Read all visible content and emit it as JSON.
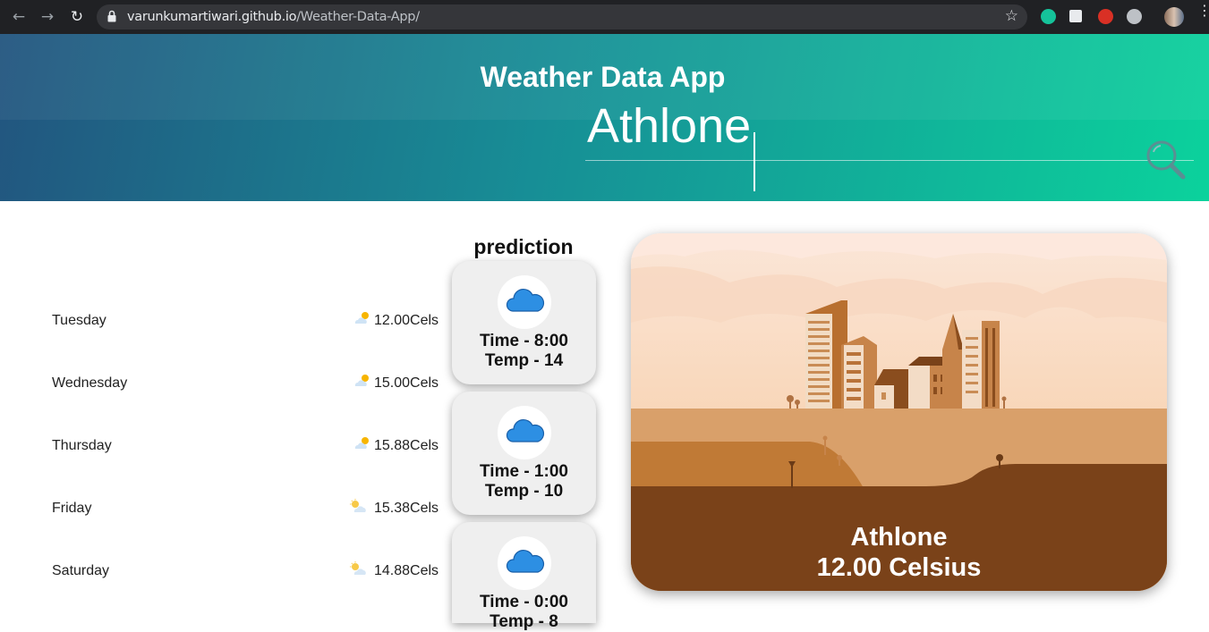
{
  "browser": {
    "url_host": "varunkumartiwari.github.io",
    "url_path": "/Weather-Data-App/",
    "icons": [
      "back-arrow-icon",
      "forward-arrow-icon",
      "reload-icon",
      "lock-icon",
      "star-icon",
      "grammarly-icon",
      "cube-extension-icon",
      "stop-hand-icon",
      "compass-extension-icon",
      "profile-avatar",
      "kebab-menu-icon"
    ]
  },
  "header": {
    "title": "Weather Data App",
    "search_value": "Athlone",
    "search_icon": "magnifier-icon"
  },
  "forecast": [
    {
      "day": "Tuesday",
      "temp": "12.00Cels",
      "icon": "sun-behind-cloud-icon"
    },
    {
      "day": "Wednesday",
      "temp": "15.00Cels",
      "icon": "sun-behind-cloud-icon"
    },
    {
      "day": "Thursday",
      "temp": "15.88Cels",
      "icon": "sun-behind-cloud-icon"
    },
    {
      "day": "Friday",
      "temp": "15.38Cels",
      "icon": "sun-with-cloud-icon"
    },
    {
      "day": "Saturday",
      "temp": "14.88Cels",
      "icon": "sun-with-cloud-icon"
    }
  ],
  "prediction": {
    "title": "prediction",
    "items": [
      {
        "time": "Time - 8:00",
        "temp": "Temp - 14",
        "icon": "cloud-icon"
      },
      {
        "time": "Time - 1:00",
        "temp": "Temp - 10",
        "icon": "cloud-icon"
      },
      {
        "time": "Time - 0:00",
        "temp": "Temp - 8",
        "icon": "cloud-icon"
      }
    ]
  },
  "city_card": {
    "name": "Athlone",
    "temperature": "12.00 Celsius",
    "illustration": "city-skyline-illustration"
  },
  "colors": {
    "header_start": "#22557f",
    "header_end": "#0bd29c",
    "card_ground": "#7a4219",
    "cloud_icon": "#2d8fe3"
  }
}
